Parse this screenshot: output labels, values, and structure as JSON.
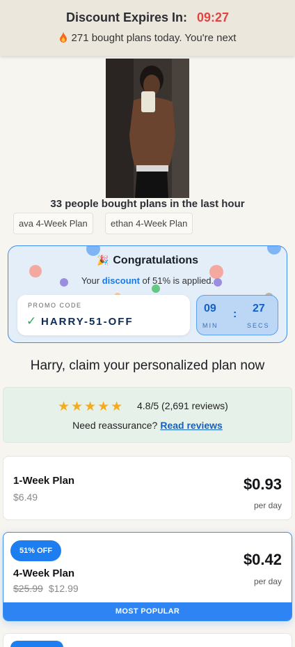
{
  "header": {
    "expires_label": "Discount Expires In:",
    "expires_timer": "09:27",
    "bought_today": "271 bought plans today. You're next"
  },
  "social_proof": {
    "text": "33 people bought plans in the last hour",
    "chips": [
      "ava 4-Week Plan",
      "ethan 4-Week Plan"
    ]
  },
  "congrats": {
    "title": "Congratulations",
    "sub_prefix": "Your",
    "sub_highlight": "discount",
    "sub_suffix": "of 51% is applied.",
    "promo_label": "PROMO CODE",
    "promo_code": "HARRY-51-OFF",
    "timer_min": "09",
    "timer_sec": "27",
    "min_label": "MIN",
    "sec_label": "SECS"
  },
  "claim_heading": "Harry, claim your personalized plan now",
  "reviews": {
    "stars": "★★★★★",
    "rating": "4.8/5 (2,691 reviews)",
    "reassure": "Need reassurance?",
    "link": "Read reviews"
  },
  "plans": [
    {
      "name": "1-Week Plan",
      "old_price": "$6.49",
      "price": "$0.93",
      "per": "per day"
    },
    {
      "badge": "51% OFF",
      "name": "4-Week Plan",
      "strike_price": "$25.99",
      "old_price": "$12.99",
      "price": "$0.42",
      "per": "per day",
      "ribbon": "MOST POPULAR"
    }
  ],
  "colors": {
    "accent": "#1e7ef0",
    "timer_red": "#e04444",
    "star": "#f3ac1e",
    "check": "#26a85e"
  },
  "icons": {
    "fire": "fire-icon",
    "party": "party-popper-icon",
    "check": "check-icon",
    "star": "star-icon"
  }
}
